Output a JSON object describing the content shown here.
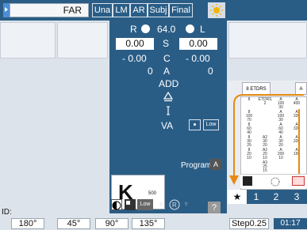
{
  "header": {
    "far_label": "FAR",
    "tabs": [
      {
        "label": "Una"
      },
      {
        "label": "LM"
      },
      {
        "label": "AR"
      },
      {
        "label": "Subj"
      },
      {
        "label": "Final"
      }
    ],
    "sun_icon": "sun-icon"
  },
  "refraction": {
    "right_label": "R",
    "pd_value": "64.0",
    "left_label": "L",
    "sph_right": "0.00",
    "sph_label": "S",
    "sph_left": "0.00",
    "cyl_right": "- 0.00",
    "cyl_label": "C",
    "cyl_left": "- 0.00",
    "axis_right": "0",
    "axis_label": "A",
    "axis_left": "0",
    "add_label": "ADD",
    "va_label": "VA",
    "low_label": "Low"
  },
  "program": {
    "label": "Program",
    "badge": "A"
  },
  "k_box": {
    "letter": "K",
    "value": "500"
  },
  "tools": {
    "low_label": "Low",
    "help_label": "?"
  },
  "chart_panel": {
    "header_top": "8",
    "header_label": "ETDRS",
    "header_right": "A",
    "rows": [
      [
        "8",
        "ETDRS\n2",
        "A\n100\n30",
        "A\n400"
      ],
      [
        "8\n100\n70",
        "",
        "A\n100\n30",
        "A\n320"
      ],
      [
        "8\n60\n40",
        "",
        "A\n60\n40",
        "A\n320"
      ],
      [
        "8\n30\n25",
        "A2\n30\n20",
        "A\n30\n20",
        "A\n320"
      ],
      [
        "8\n20\n10",
        "A2\n20\n10",
        "A\n200\n10",
        "A\n150"
      ],
      [
        "",
        "A3\n25\n15",
        "",
        ""
      ]
    ],
    "tabs": [
      {
        "label": "★"
      },
      {
        "label": "1"
      },
      {
        "label": "2"
      },
      {
        "label": "3"
      }
    ]
  },
  "footer": {
    "id_label": "ID:",
    "axis_buttons": [
      "180°",
      "45°",
      "90°",
      "135°"
    ],
    "step_label": "Step0.25",
    "time": "01:17"
  },
  "colors": {
    "panel_blue": "#2a5d86",
    "arrow_orange": "#e58a12",
    "background": "#dbe1e8"
  }
}
